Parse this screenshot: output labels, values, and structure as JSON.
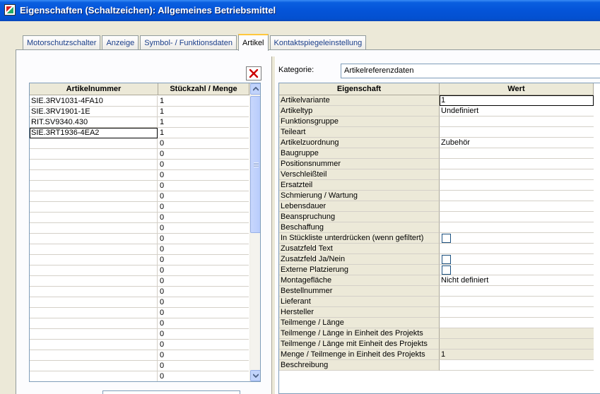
{
  "window": {
    "title": "Eigenschaften (Schaltzeichen): Allgemeines Betriebsmittel"
  },
  "tabs": [
    {
      "label": "Motorschutzschalter",
      "active": false
    },
    {
      "label": "Anzeige",
      "active": false
    },
    {
      "label": "Symbol- / Funktionsdaten",
      "active": false
    },
    {
      "label": "Artikel",
      "active": true
    },
    {
      "label": "Kontaktspiegeleinstellung",
      "active": false
    }
  ],
  "article_table": {
    "headers": {
      "article": "Artikelnummer",
      "quantity": "Stückzahl / Menge"
    },
    "rows": [
      {
        "article": "SIE.3RV1031-4FA10",
        "quantity": "1"
      },
      {
        "article": "SIE.3RV1901-1E",
        "quantity": "1"
      },
      {
        "article": "RIT.SV9340.430",
        "quantity": "1"
      },
      {
        "article": "SIE.3RT1936-4EA2",
        "quantity": "1"
      },
      {
        "article": "",
        "quantity": "0"
      },
      {
        "article": "",
        "quantity": "0"
      },
      {
        "article": "",
        "quantity": "0"
      },
      {
        "article": "",
        "quantity": "0"
      },
      {
        "article": "",
        "quantity": "0"
      },
      {
        "article": "",
        "quantity": "0"
      },
      {
        "article": "",
        "quantity": "0"
      },
      {
        "article": "",
        "quantity": "0"
      },
      {
        "article": "",
        "quantity": "0"
      },
      {
        "article": "",
        "quantity": "0"
      },
      {
        "article": "",
        "quantity": "0"
      },
      {
        "article": "",
        "quantity": "0"
      },
      {
        "article": "",
        "quantity": "0"
      },
      {
        "article": "",
        "quantity": "0"
      },
      {
        "article": "",
        "quantity": "0"
      },
      {
        "article": "",
        "quantity": "0"
      },
      {
        "article": "",
        "quantity": "0"
      },
      {
        "article": "",
        "quantity": "0"
      },
      {
        "article": "",
        "quantity": "0"
      },
      {
        "article": "",
        "quantity": "0"
      },
      {
        "article": "",
        "quantity": "0"
      },
      {
        "article": "",
        "quantity": "0"
      },
      {
        "article": "",
        "quantity": "0"
      }
    ],
    "selected_row": 3
  },
  "category": {
    "label": "Kategorie:",
    "value": "Artikelreferenzdaten"
  },
  "property_table": {
    "headers": {
      "property": "Eigenschaft",
      "value": "Wert"
    },
    "rows": [
      {
        "property": "Artikelvariante",
        "value": "1",
        "type": "text",
        "selected": true
      },
      {
        "property": "Artikeltyp",
        "value": "Undefiniert",
        "type": "text"
      },
      {
        "property": "Funktionsgruppe",
        "value": "",
        "type": "text"
      },
      {
        "property": "Teileart",
        "value": "",
        "type": "text"
      },
      {
        "property": "Artikelzuordnung",
        "value": "Zubehör",
        "type": "text"
      },
      {
        "property": "Baugruppe",
        "value": "",
        "type": "text"
      },
      {
        "property": "Positionsnummer",
        "value": "",
        "type": "text"
      },
      {
        "property": "Verschleißteil",
        "value": "",
        "type": "text"
      },
      {
        "property": "Ersatzteil",
        "value": "",
        "type": "text"
      },
      {
        "property": "Schmierung / Wartung",
        "value": "",
        "type": "text"
      },
      {
        "property": "Lebensdauer",
        "value": "",
        "type": "text"
      },
      {
        "property": "Beanspruchung",
        "value": "",
        "type": "text"
      },
      {
        "property": "Beschaffung",
        "value": "",
        "type": "text"
      },
      {
        "property": "In Stückliste unterdrücken (wenn gefiltert)",
        "value": "",
        "type": "checkbox"
      },
      {
        "property": "Zusatzfeld Text",
        "value": "",
        "type": "text"
      },
      {
        "property": "Zusatzfeld Ja/Nein",
        "value": "",
        "type": "checkbox"
      },
      {
        "property": "Externe Platzierung",
        "value": "",
        "type": "checkbox"
      },
      {
        "property": "Montagefläche",
        "value": "Nicht definiert",
        "type": "text"
      },
      {
        "property": "Bestellnummer",
        "value": "",
        "type": "text"
      },
      {
        "property": "Lieferant",
        "value": "",
        "type": "text"
      },
      {
        "property": "Hersteller",
        "value": "",
        "type": "text"
      },
      {
        "property": "Teilmenge / Länge",
        "value": "",
        "type": "text"
      },
      {
        "property": "Teilmenge / Länge in Einheit des Projekts",
        "value": "",
        "type": "readonly"
      },
      {
        "property": "Teilmenge / Länge mit Einheit des Projekts",
        "value": "",
        "type": "readonly"
      },
      {
        "property": "Menge / Teilmenge in Einheit des Projekts",
        "value": "1",
        "type": "readonly"
      },
      {
        "property": "Beschreibung",
        "value": "",
        "type": "text"
      }
    ]
  },
  "icons": {
    "app": "app-icon",
    "delete": "delete-x-icon",
    "scroll_up": "scroll-up-icon",
    "scroll_down": "scroll-down-icon"
  },
  "colors": {
    "titlebar": "#0454d8",
    "tab_highlight": "#ffc83c",
    "delete_red": "#cc0000",
    "grid_border": "#7f9db9"
  }
}
